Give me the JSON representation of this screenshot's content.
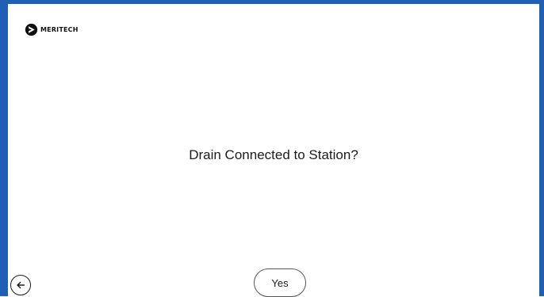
{
  "brand": {
    "name": "MERITECH",
    "logo_icon": "meritech-logo-icon"
  },
  "prompt": {
    "question": "Drain Connected to Station?"
  },
  "actions": {
    "yes_label": "Yes",
    "back_icon": "arrow-left-icon"
  },
  "colors": {
    "frame_border": "#1f5fb5",
    "background": "#ffffff",
    "text": "#1c1c1c"
  }
}
